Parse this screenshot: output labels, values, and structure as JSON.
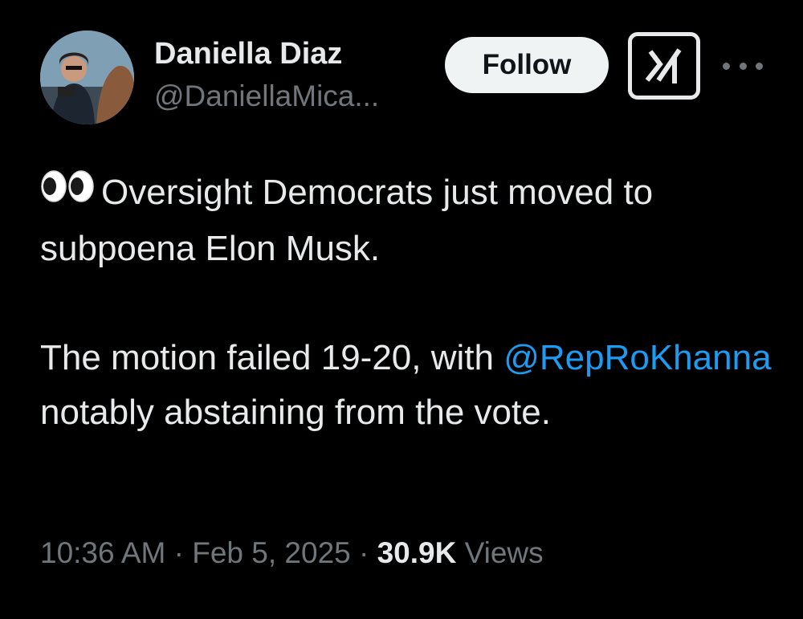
{
  "author": {
    "display_name": "Daniella Diaz",
    "handle": "@DaniellaMica..."
  },
  "actions": {
    "follow_label": "Follow",
    "grok_icon": "grok-icon",
    "more_icon": "more-options-icon"
  },
  "tweet": {
    "emoji": "👀",
    "line1": "Oversight Democrats just moved to subpoena Elon Musk.",
    "line2_before": "The motion failed 19-20, with ",
    "mention": "@RepRoKhanna",
    "line2_after": " notably abstaining from the vote."
  },
  "meta": {
    "time": "10:36 AM",
    "separator": " · ",
    "date": "Feb 5, 2025",
    "views_count": "30.9K",
    "views_label": "Views"
  },
  "colors": {
    "background": "#000000",
    "text": "#e7e9ea",
    "secondary": "#71767b",
    "link": "#1d9bf0",
    "button_bg": "#eff3f4"
  }
}
